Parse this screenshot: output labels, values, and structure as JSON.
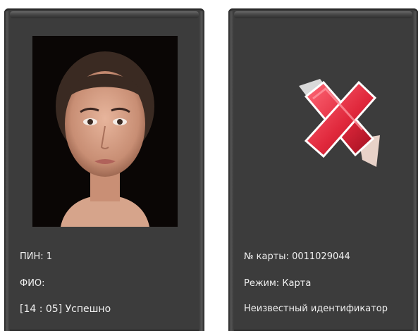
{
  "left_panel": {
    "photo": "face-photo",
    "pin_line": "ПИН: 1",
    "name_line": "ФИО:",
    "status_line": "[14 : 05] Успешно"
  },
  "right_panel": {
    "status_icon": "red-x-icon",
    "card_line": "№ карты: 0011029044",
    "mode_line": "Режим: Карта",
    "result_line": "Неизвестный идентификатор"
  },
  "colors": {
    "panel_bg": "#3c3c3c",
    "text": "#f0f0f0",
    "cross_red": "#e0283c"
  }
}
